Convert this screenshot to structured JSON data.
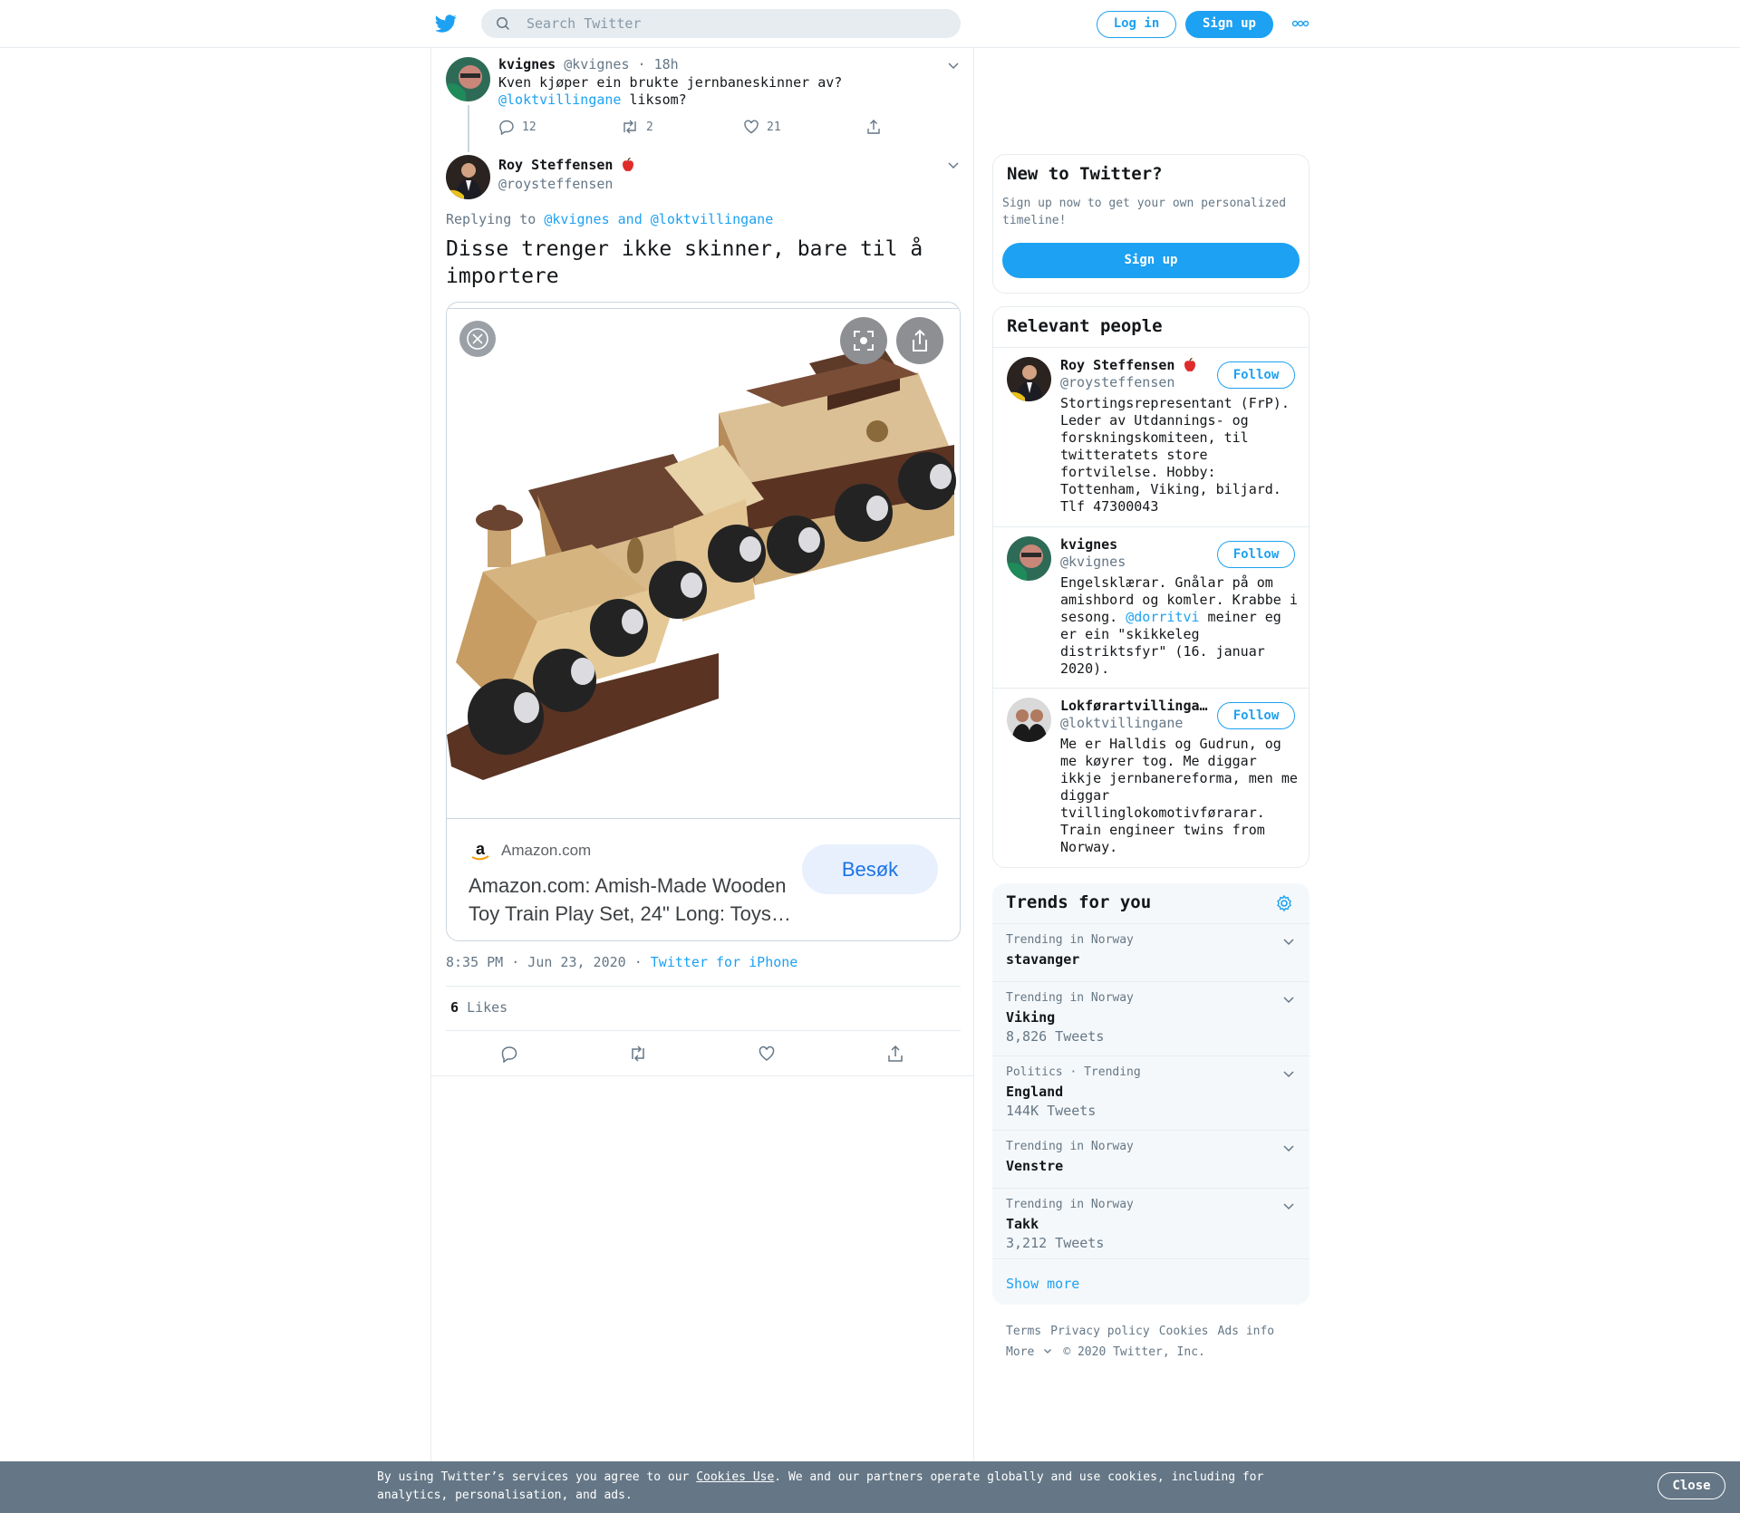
{
  "header": {
    "search_placeholder": "Search Twitter",
    "login_label": "Log in",
    "signup_label": "Sign up"
  },
  "parent_tweet": {
    "name": "kvignes",
    "handle": "@kvignes",
    "time": "· 18h",
    "text_line1": "Kven kjøper ein brukte jernbaneskinner av?",
    "mention": "@loktvillingane",
    "text_tail": " liksom?",
    "replies": "12",
    "retweets": "2",
    "likes": "21"
  },
  "focused_tweet": {
    "name": "Roy Steffensen",
    "handle": "@roysteffensen",
    "replying_prefix": "Replying to ",
    "replying_to_1": "@kvignes",
    "replying_and": " and ",
    "replying_to_2": "@loktvillingane",
    "text": "Disse trenger ikke skinner, bare til å importere",
    "timestamp": "8:35 PM · Jun 23, 2020 ·",
    "source": "Twitter for iPhone",
    "likes_count": "6",
    "likes_label": "Likes"
  },
  "card": {
    "domain": "Amazon.com",
    "title": "Amazon.com: Amish-Made Wooden Toy Train Play Set, 24\" Long: Toys…",
    "visit_label": "Besøk"
  },
  "sidebar": {
    "new_title": "New to Twitter?",
    "new_text": "Sign up now to get your own personalized timeline!",
    "new_signup": "Sign up",
    "people_title": "Relevant people",
    "follow_label": "Follow",
    "people": [
      {
        "name": "Roy Steffensen",
        "handle": "@roysteffensen",
        "bio": "Stortingsrepresentant (FrP). Leder av Utdannings- og forskningskomiteen, til twitteratets store fortvilelse. Hobby: Tottenham, Viking, biljard. Tlf 47300043"
      },
      {
        "name": "kvignes",
        "handle": "@kvignes",
        "bio_before": "Engelsklærar. Gnålar på om amishbord og komler. Krabbe i sesong. ",
        "bio_mention": "@dorritvi",
        "bio_after": " meiner eg er ein \"skikkeleg distriktsfyr\" (16. januar 2020)."
      },
      {
        "name": "Lokførartvillinga…",
        "handle": "@loktvillingane",
        "bio": "Me er Halldis og Gudrun, og me køyrer tog. Me diggar ikkje jernbanereforma, men me diggar tvillinglokomotivførarar. Train engineer twins from Norway."
      }
    ],
    "trends_title": "Trends for you",
    "trends": [
      {
        "context": "Trending in Norway",
        "name": "stavanger",
        "count": ""
      },
      {
        "context": "Trending in Norway",
        "name": "Viking",
        "count": "8,826 Tweets"
      },
      {
        "context": "Politics · Trending",
        "name": "England",
        "count": "144K Tweets"
      },
      {
        "context": "Trending in Norway",
        "name": "Venstre",
        "count": ""
      },
      {
        "context": "Trending in Norway",
        "name": "Takk",
        "count": "3,212 Tweets"
      }
    ],
    "show_more": "Show more"
  },
  "footer": {
    "terms": "Terms",
    "privacy": "Privacy policy",
    "cookies": "Cookies",
    "ads": "Ads info",
    "more": "More",
    "copyright": "© 2020 Twitter, Inc."
  },
  "cookie_banner": {
    "text_before": "By using Twitter’s services you agree to our ",
    "link": "Cookies Use",
    "text_after": ". We and our partners operate globally and use cookies, including for analytics, personalisation, and ads.",
    "close_label": "Close"
  },
  "colors": {
    "accent": "#1da1f2",
    "banner": "#657786"
  }
}
